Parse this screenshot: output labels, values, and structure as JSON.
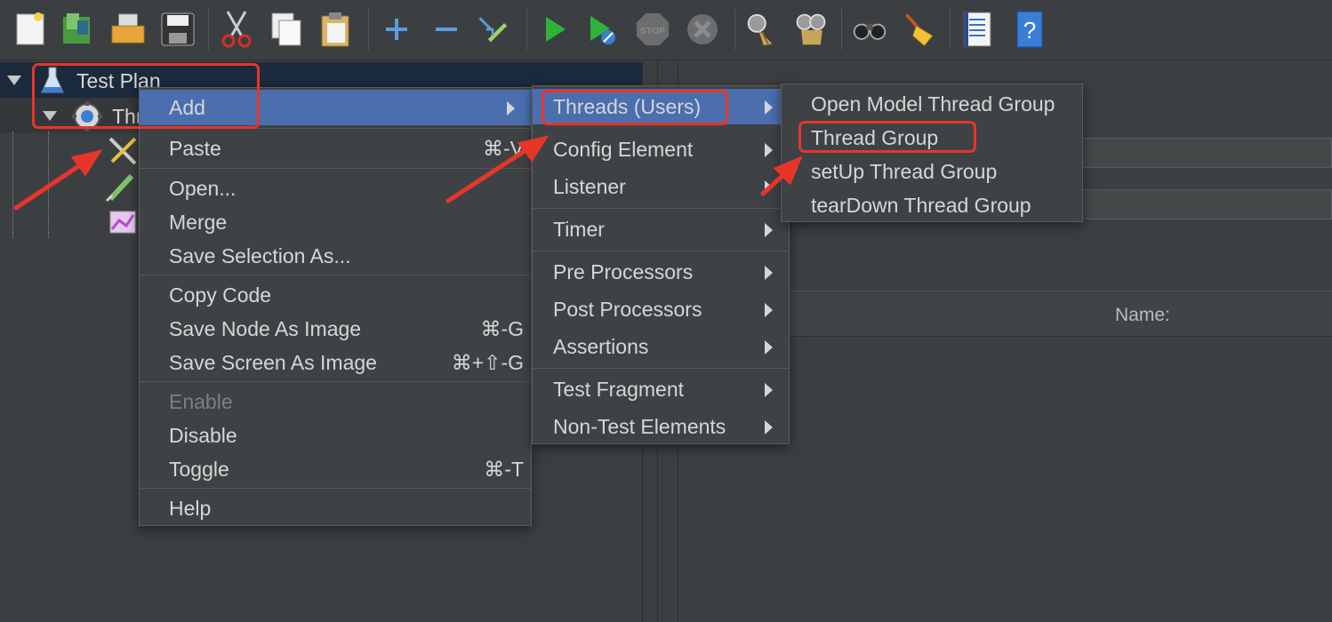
{
  "tree": {
    "test_plan": "Test Plan",
    "thread_group_partial": "Thr"
  },
  "context_menu": {
    "add": "Add",
    "paste": "Paste",
    "paste_shortcut": "⌘-V",
    "open": "Open...",
    "merge": "Merge",
    "save_selection_as": "Save Selection As...",
    "copy_code": "Copy Code",
    "save_node_as_image": "Save Node As Image",
    "save_node_shortcut": "⌘-G",
    "save_screen_as_image": "Save Screen As Image",
    "save_screen_shortcut": "⌘+⇧-G",
    "enable": "Enable",
    "disable": "Disable",
    "toggle": "Toggle",
    "toggle_shortcut": "⌘-T",
    "help": "Help"
  },
  "add_submenu": {
    "threads_users": "Threads (Users)",
    "config_element": "Config Element",
    "listener": "Listener",
    "timer": "Timer",
    "pre_processors": "Pre Processors",
    "post_processors": "Post Processors",
    "assertions": "Assertions",
    "test_fragment": "Test Fragment",
    "non_test_elements": "Non-Test Elements"
  },
  "threads_submenu": {
    "open_model_thread_group": "Open Model Thread Group",
    "thread_group": "Thread Group",
    "setup_thread_group": "setUp Thread Group",
    "teardown_thread_group": "tearDown Thread Group"
  },
  "right_pane": {
    "name_label": "Name:"
  },
  "toolbar_icons": [
    "new-icon",
    "templates-icon",
    "open-icon",
    "save-icon",
    "cut-icon",
    "copy-icon",
    "paste-icon",
    "expand-icon",
    "collapse-icon",
    "toggle-icon",
    "start-icon",
    "start-no-pause-icon",
    "stop-icon",
    "shutdown-icon",
    "clear-icon",
    "clear-all-icon",
    "search-icon",
    "reset-search-icon",
    "function-helper-icon",
    "help-icon"
  ],
  "colors": {
    "highlight": "#4b6eaf",
    "annotation_red": "#e8352a",
    "background": "#3c3f41"
  }
}
